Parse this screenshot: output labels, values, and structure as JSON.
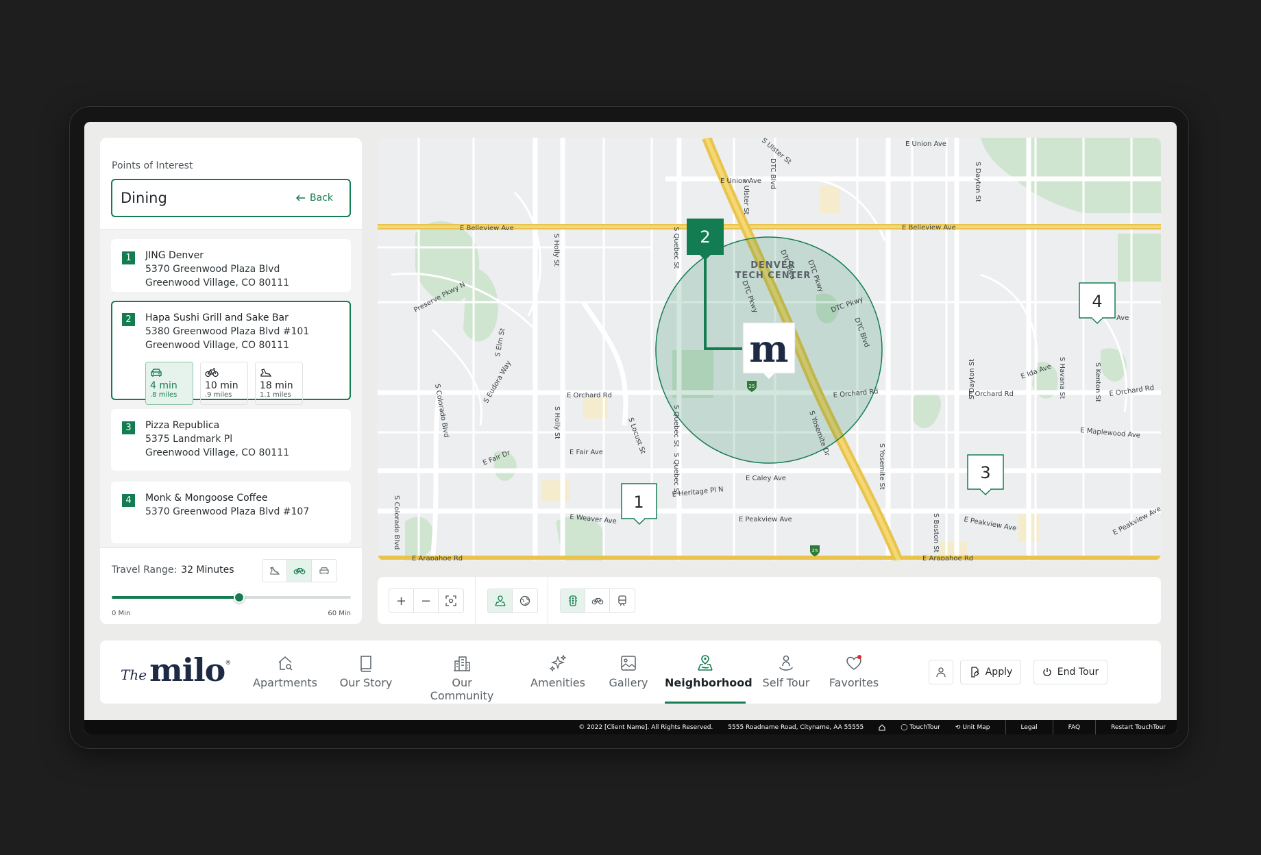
{
  "poi": {
    "label": "Points of Interest",
    "category": "Dining",
    "back_label": "Back"
  },
  "places": [
    {
      "num": "1",
      "name": "JING Denver",
      "addr1": "5370 Greenwood Plaza Blvd",
      "addr2": "Greenwood Village, CO 80111"
    },
    {
      "num": "2",
      "name": "Hapa Sushi Grill and Sake Bar",
      "addr1": "5380 Greenwood Plaza Blvd #101",
      "addr2": "Greenwood Village, CO 80111",
      "modes": [
        {
          "icon": "car-icon",
          "time": "4 min",
          "dist": ".8 miles",
          "active": true
        },
        {
          "icon": "bike-icon",
          "time": "10 min",
          "dist": ".9 miles",
          "active": false
        },
        {
          "icon": "walk-icon",
          "time": "18 min",
          "dist": "1.1 miles",
          "active": false
        }
      ]
    },
    {
      "num": "3",
      "name": "Pizza Republica",
      "addr1": "5375 Landmark Pl",
      "addr2": "Greenwood Village, CO 80111"
    },
    {
      "num": "4",
      "name": "Monk & Mongoose Coffee",
      "addr1": "5370 Greenwood Plaza Blvd #107",
      "addr2": ""
    }
  ],
  "travel": {
    "label": "Travel Range:",
    "value": "32 Minutes",
    "fraction": 0.5333,
    "min_label": "0 Min",
    "max_label": "60 Min",
    "modes": [
      "walk-icon",
      "bike-icon",
      "car-icon"
    ],
    "active_mode": "bike-icon"
  },
  "map": {
    "markers": [
      "1",
      "2",
      "3",
      "4"
    ],
    "center_logo": "m",
    "streets": {
      "belleview_w": "E Belleview Ave",
      "belleview_e": "E Belleview Ave",
      "union": "E Union Ave",
      "union_ne": "E Union Ave",
      "orchard_w": "E Orchard Rd",
      "orchard_m": "E Orchard Rd",
      "orchard_e": "E Orchard Rd",
      "orchard_far": "E Orchard Rd",
      "fair": "E Fair Ave",
      "fair_dr": "E Fair Dr",
      "heritage": "E Heritage Pl N",
      "caley": "E Caley Ave",
      "peakview": "E Peakview Ave",
      "peakview2": "E Peakview Ave",
      "peakview3": "E Peakview Ave",
      "weaver": "E Weaver Ave",
      "maplewood": "E Maplewood Ave",
      "ida": "E Ida Ave",
      "arapahoe": "E Arapahoe Rd",
      "arapahoe2": "E Arapahoe Rd",
      "preserve": "Preserve Pkwy N",
      "holly": "S Holly St",
      "holly2": "S Holly St",
      "quebec": "S Quebec St",
      "quebec2": "S Quebec St",
      "quebec3": "S Quebec St",
      "ulster": "S Ulster St",
      "ulster2": "S Ulster St",
      "dtc_blvd": "DTC Blvd",
      "dtc_blvd2": "DTC Blvd",
      "dtc_blvd3": "DTC Blvd",
      "dtc_pkwy": "DTC Pkwy",
      "dtc_pkwy2": "DTC Pkwy",
      "dtc_pkwy3": "DTC Pkwy",
      "colorado": "S Colorado Blvd",
      "colorado2": "S Colorado Blvd",
      "eudora": "S Eudora Way",
      "elm": "S Elm St",
      "locust": "S Locust St",
      "yosemite": "S Yosemite St",
      "yosemite_dr": "S Yosemite Dr",
      "dayton": "S Dayton St",
      "dayton2": "S Dayton St",
      "havana": "S Havana St",
      "kenton": "S Kenton St",
      "boston": "S Boston St",
      "denver_tech_1": "DENVER",
      "denver_tech_2": "TECH CENTER",
      "ave": "Ave",
      "i25": "25"
    }
  },
  "toolbar": {
    "zoom_in": "+",
    "zoom_out": "−"
  },
  "nav": {
    "logo_the": "The",
    "logo_milo": "milo",
    "logo_reg": "®",
    "items": [
      {
        "label": "Apartments",
        "icon": "home-search-icon"
      },
      {
        "label": "Our Story",
        "icon": "book-icon"
      },
      {
        "label": "Our Community",
        "icon": "building-icon"
      },
      {
        "label": "Amenities",
        "icon": "sparkles-icon"
      },
      {
        "label": "Gallery",
        "icon": "image-icon"
      },
      {
        "label": "Neighborhood",
        "icon": "map-pin-icon",
        "active": true
      },
      {
        "label": "Self Tour",
        "icon": "person-pin-icon"
      },
      {
        "label": "Favorites",
        "icon": "heart-icon"
      }
    ],
    "apply_label": "Apply",
    "end_tour_label": "End Tour"
  },
  "footer": {
    "copyright": "© 2022 [Client Name]. All Rights Reserved.",
    "address": "5555 Roadname Road, Cityname, AA 55555",
    "touchtour": "TouchTour",
    "unitmap": "Unit Map",
    "legal": "Legal",
    "faq": "FAQ",
    "restart": "Restart TouchTour"
  },
  "colors": {
    "brand_green": "#137c50",
    "brand_navy": "#1d2a44",
    "highway": "#e9c34b",
    "park": "#c9e3c9"
  }
}
